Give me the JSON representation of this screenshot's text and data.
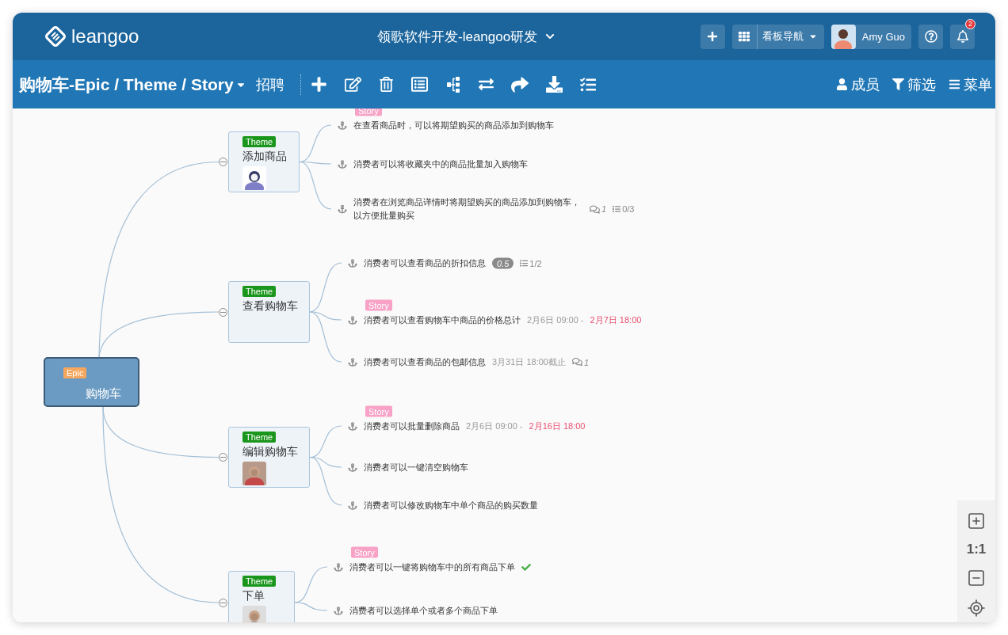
{
  "header": {
    "logo": "leangoo",
    "project_title": "领歌软件开发-leangoo研发",
    "nav_label": "看板导航",
    "user_name": "Amy Guo",
    "notification_count": "2"
  },
  "toolbar": {
    "title": "购物车-Epic / Theme / Story",
    "tag": "招聘",
    "right_buttons": [
      {
        "kind": "members",
        "label": "成员"
      },
      {
        "kind": "filter",
        "label": "筛选"
      },
      {
        "kind": "menu",
        "label": "菜单"
      }
    ]
  },
  "mindmap": {
    "epic": {
      "tag": "Epic",
      "title": "购物车"
    },
    "themes": [
      {
        "tag": "Theme",
        "title": "添加商品",
        "avatar": {
          "kind": "picture"
        },
        "stories": [
          {
            "tag": "Story",
            "text": "在查看商品时，可以将期望购买的商品添加到购物车",
            "done": false
          },
          {
            "text": "消费者可以将收藏夹中的商品批量加入购物车",
            "done": false
          },
          {
            "text": "消费者在浏览商品详情时将期望购买的商品添加到购物车，以方便批量购买",
            "comments": "1",
            "checklist": "0/3",
            "done": false
          }
        ]
      },
      {
        "tag": "Theme",
        "title": "查看购物车",
        "stories": [
          {
            "text": "消费者可以查看商品的折扣信息",
            "estimate": "0.5",
            "checklist": "1/2",
            "done": false
          },
          {
            "tag": "Story",
            "text": "消费者可以查看购物车中商品的价格总计",
            "start": "2月6日 09:00 -",
            "due": "2月7日 18:00",
            "overdue": true,
            "done": false
          },
          {
            "text": "消费者可以查看商品的包邮信息",
            "deadline": "3月31日 18:00截止",
            "comments": "1",
            "done": false
          }
        ]
      },
      {
        "tag": "Theme",
        "title": "编辑购物车",
        "avatar": {
          "kind": "picture"
        },
        "stories": [
          {
            "tag": "Story",
            "text": "消费者可以批量删除商品",
            "start": "2月6日 09:00 -",
            "due": "2月16日 18:00",
            "overdue": true,
            "done": false
          },
          {
            "text": "消费者可以一键清空购物车",
            "done": false
          },
          {
            "text": "消费者可以修改购物车中单个商品的购买数量",
            "done": false
          }
        ]
      },
      {
        "tag": "Theme",
        "title": "下单",
        "avatar": {
          "kind": "picture"
        },
        "stories": [
          {
            "tag": "Story",
            "text": "消费者可以一键将购物车中的所有商品下单",
            "done": true
          },
          {
            "text": "消费者可以选择单个或者多个商品下单",
            "done": false
          }
        ]
      }
    ]
  },
  "zoom": {
    "ratio": "1:1"
  }
}
